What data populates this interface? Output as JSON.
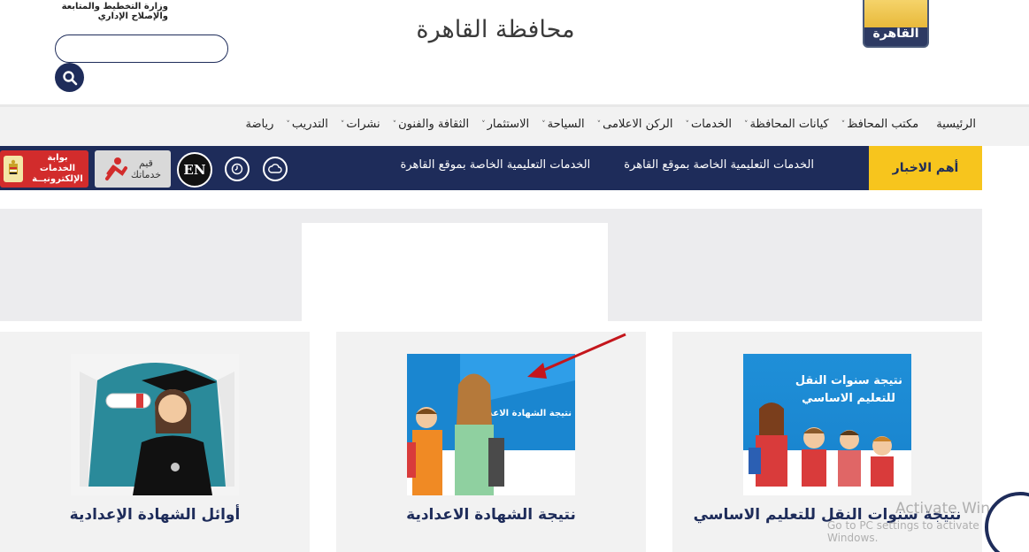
{
  "header": {
    "ministry_text": "وزارة التخطيط والمتابعة والإصلاح الإداري",
    "site_title": "محافظة القاهرة",
    "logo_text": "القاهرة",
    "search": {
      "placeholder": "",
      "value": ""
    }
  },
  "nav": {
    "items": [
      {
        "label": "الرئيسية",
        "has_dropdown": false
      },
      {
        "label": "مكتب المحافظ",
        "has_dropdown": true
      },
      {
        "label": "كيانات المحافظة",
        "has_dropdown": true
      },
      {
        "label": "الخدمات",
        "has_dropdown": true
      },
      {
        "label": "الركن الاعلامى",
        "has_dropdown": true
      },
      {
        "label": "السياحة",
        "has_dropdown": true
      },
      {
        "label": "الاستثمار",
        "has_dropdown": true
      },
      {
        "label": "الثقافة والفنون",
        "has_dropdown": true
      },
      {
        "label": "نشرات",
        "has_dropdown": true
      },
      {
        "label": "التدريب",
        "has_dropdown": true
      },
      {
        "label": "رياضة",
        "has_dropdown": false
      }
    ]
  },
  "newsbar": {
    "label": "أهم الاخبار",
    "ticker": [
      "الخدمات التعليمية الخاصة بموقع القاهرة",
      "الخدمات التعليمية الخاصة بموقع القاهرة"
    ],
    "en_label": "EN",
    "qayem_line1": "قيم",
    "qayem_line2": "خدماتك",
    "portal_line1": "بوابة الخدمات",
    "portal_line2": "الإلكترونيــة"
  },
  "cards": [
    {
      "caption": "نتيجة سنوات النقل للتعليم الاساسي",
      "image_text_line1": "نتيجة سنوات النقل",
      "image_text_line2": "للتعليم الاساسي"
    },
    {
      "caption": "نتيجة الشهادة الاعدادية",
      "image_text_line1": "نتيجة الشهادة الاعدادية"
    },
    {
      "caption": "أوائل الشهادة الإعدادية"
    }
  ],
  "watermark": {
    "title": "Activate Windows",
    "subtitle": "Go to PC settings to activate Windows."
  },
  "colors": {
    "navy": "#1e2c5a",
    "yellow": "#f7c51d",
    "red": "#d22c2c",
    "image_blue": "#1a86d0"
  }
}
